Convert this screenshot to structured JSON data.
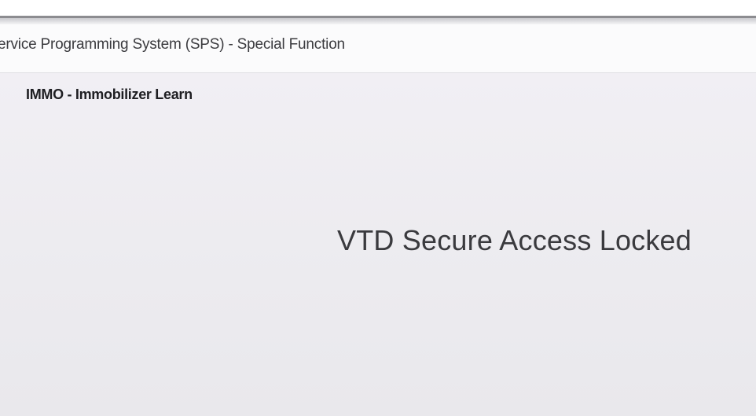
{
  "window": {
    "title": "ervice Programming System (SPS) - Special Function"
  },
  "panel": {
    "title": "IMMO - Immobilizer Learn",
    "status_message": "VTD Secure Access Locked"
  }
}
